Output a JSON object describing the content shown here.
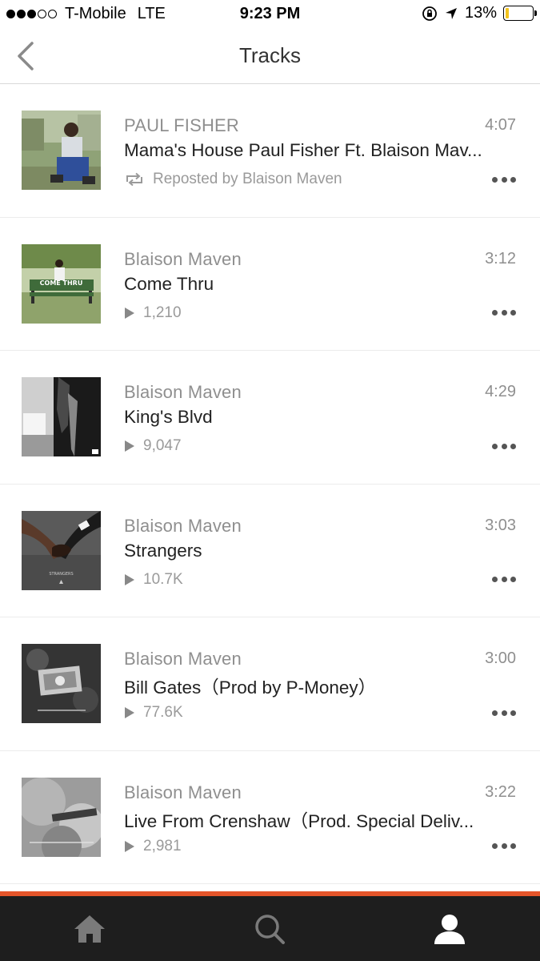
{
  "status_bar": {
    "carrier": "T-Mobile",
    "network": "LTE",
    "time": "9:23 PM",
    "battery": "13%",
    "signal_dots_filled": 3,
    "signal_dots_total": 5,
    "battery_level": 0.13,
    "battery_color": "#f2c31d"
  },
  "header": {
    "title": "Tracks",
    "back_icon": "chevron-left-icon"
  },
  "tracks": [
    {
      "artist": "PAUL FISHER",
      "title": "Mama's House Paul Fisher Ft. Blaison Mav...",
      "duration": "4:07",
      "meta_type": "repost",
      "meta_icon": "repost-icon",
      "meta_text": "Reposted by Blaison Maven"
    },
    {
      "artist": "Blaison Maven",
      "title": "Come Thru",
      "duration": "3:12",
      "meta_type": "plays",
      "meta_icon": "play-icon",
      "meta_text": "1,210",
      "artwork_caption": "COME THRU"
    },
    {
      "artist": "Blaison Maven",
      "title": "King's Blvd",
      "duration": "4:29",
      "meta_type": "plays",
      "meta_icon": "play-icon",
      "meta_text": "9,047"
    },
    {
      "artist": "Blaison Maven",
      "title": "Strangers",
      "duration": "3:03",
      "meta_type": "plays",
      "meta_icon": "play-icon",
      "meta_text": "10.7K",
      "artwork_caption": "STRANGERS"
    },
    {
      "artist": "Blaison Maven",
      "title": "Bill Gates（Prod by P-Money）",
      "duration": "3:00",
      "meta_type": "plays",
      "meta_icon": "play-icon",
      "meta_text": "77.6K"
    },
    {
      "artist": "Blaison Maven",
      "title": "Live From Crenshaw（Prod. Special Deliv...",
      "duration": "3:22",
      "meta_type": "plays",
      "meta_icon": "play-icon",
      "meta_text": "2,981"
    }
  ],
  "tab_bar": {
    "tabs": [
      {
        "name": "home",
        "icon": "home-icon"
      },
      {
        "name": "search",
        "icon": "search-icon"
      },
      {
        "name": "profile",
        "icon": "profile-icon",
        "active": true
      }
    ],
    "accent_color": "#e5552a",
    "background_color": "#1e1e1e"
  }
}
